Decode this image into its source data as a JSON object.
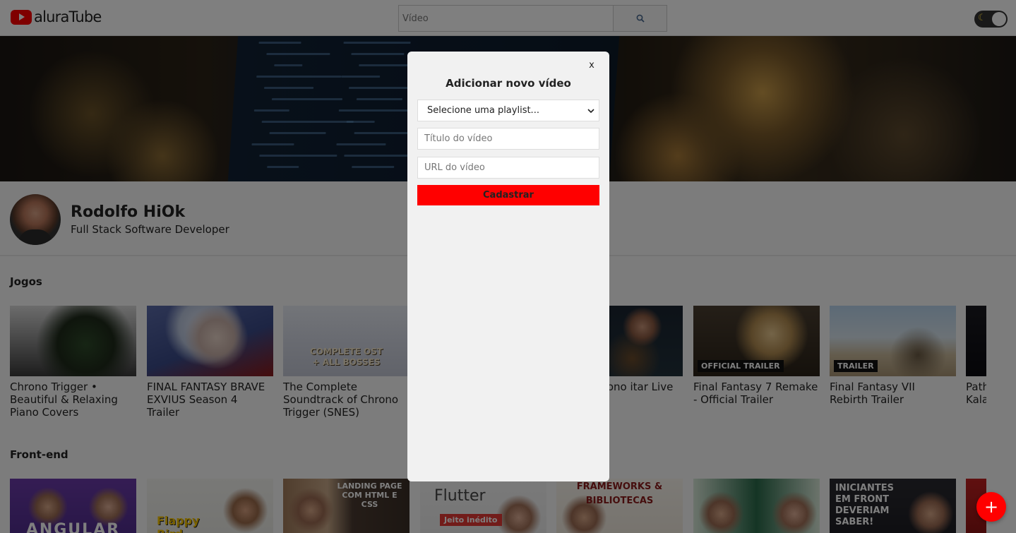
{
  "header": {
    "logo_text": "aluraTube",
    "search_placeholder": "Vídeo",
    "search_icon": "search-icon",
    "theme_icon": "moon-icon"
  },
  "profile": {
    "name": "Rodolfo HiOk",
    "role": "Full Stack Software Developer"
  },
  "sections": [
    {
      "title": "Jogos",
      "videos": [
        {
          "title": "Chrono Trigger • Beautiful & Relaxing Piano Covers"
        },
        {
          "title": "FINAL FANTASY BRAVE EXVIUS Season 4 Trailer"
        },
        {
          "title": "The Complete Soundtrack of Chrono Trigger (SNES)",
          "thumb_line1": "COMPLETE OST",
          "thumb_line2": "+ ALL BOSSES"
        },
        {
          "title": "oss & Chrono itar Live Set"
        },
        {
          "title": "Final Fantasy 7 Remake - Official Trailer",
          "badge": "OFFICIAL TRAILER"
        },
        {
          "title": "Final Fantasy VII Rebirth Trailer",
          "badge": "TRAILER"
        },
        {
          "title": "Path Kala"
        }
      ]
    },
    {
      "title": "Front-end",
      "videos": [
        {
          "title": "",
          "thumb_text": "ANGULAR"
        },
        {
          "title": "",
          "thumb_text": "Flappy Bird"
        },
        {
          "title": "",
          "thumb_text": "LANDING PAGE COM HTML E CSS"
        },
        {
          "title": "",
          "thumb_text": "Flutter",
          "thumb_tag": "Jeito inédito"
        },
        {
          "title": "",
          "thumb_text": "FRAMEWORKS & BIBLIOTECAS"
        },
        {
          "title": "",
          "thumb_text": ""
        },
        {
          "title": "",
          "thumb_text": "INICIANTES EM FRONT DEVERIAM SABER!"
        }
      ]
    }
  ],
  "modal": {
    "close_label": "x",
    "title": "Adicionar novo vídeo",
    "playlist_selected": "Selecione uma playlist...",
    "title_placeholder": "Título do vídeo",
    "url_placeholder": "URL do vídeo",
    "submit_label": "Cadastrar"
  },
  "fab_label": "+",
  "colors": {
    "brand_red": "#ff0000",
    "overlay": "rgba(0,0,0,0.5)",
    "modal_bg": "#f1f1f1"
  }
}
